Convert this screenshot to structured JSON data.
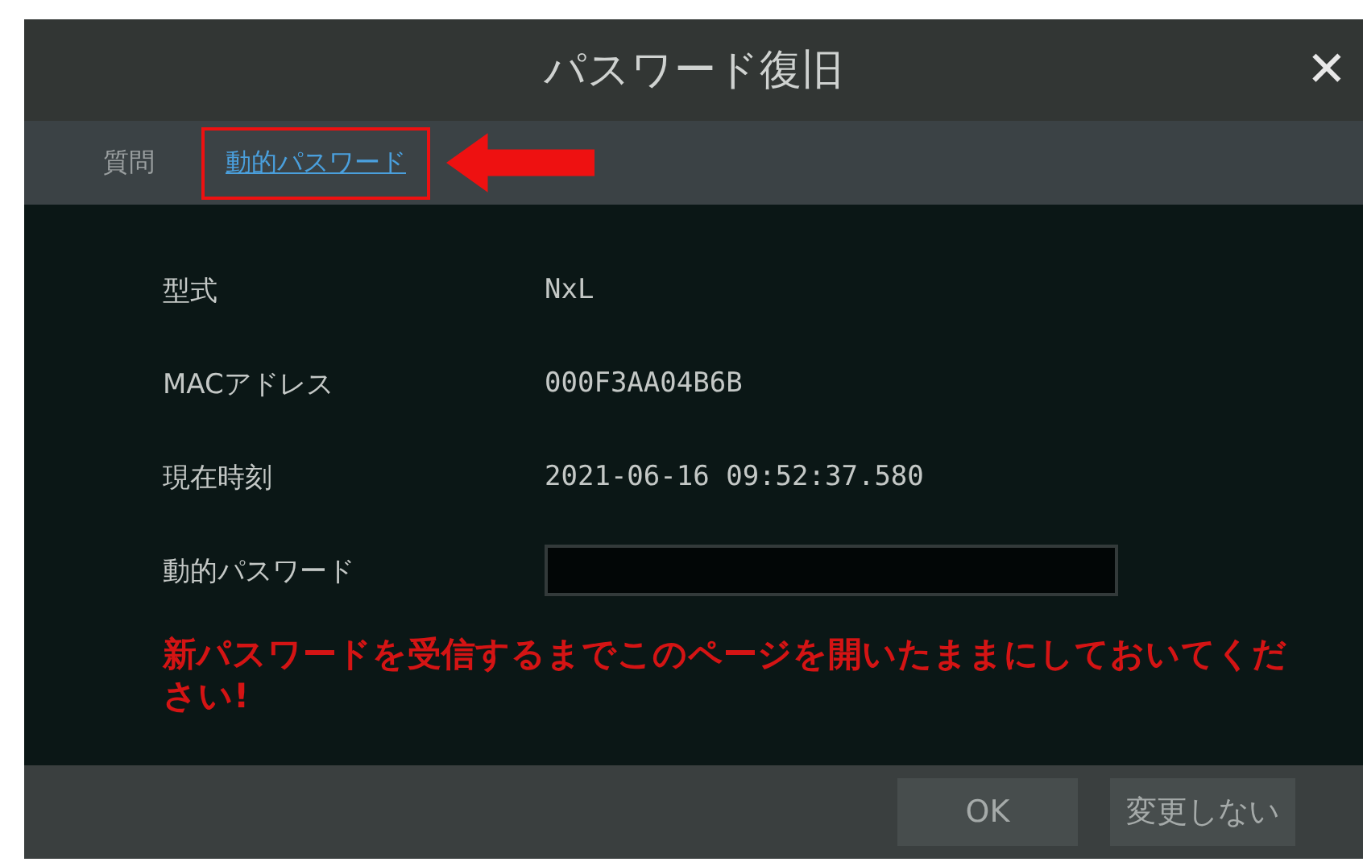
{
  "window": {
    "title": "パスワード復旧",
    "close": "✕"
  },
  "tabs": [
    {
      "label": "質問",
      "selected": false
    },
    {
      "label": "動的パスワード",
      "selected": true
    }
  ],
  "fields": [
    {
      "label": "型式",
      "value": "NxL",
      "kind": "text"
    },
    {
      "label": "MACアドレス",
      "value": "000F3AA04B6B",
      "kind": "text"
    },
    {
      "label": "現在時刻",
      "value": "2021-06-16 09:52:37.580",
      "kind": "text"
    },
    {
      "label": "動的パスワード",
      "kind": "input"
    }
  ],
  "warning": "新パスワードを受信するまでこのページを開いたままにしておいてください!",
  "buttons": [
    "OK",
    "変更しない"
  ]
}
